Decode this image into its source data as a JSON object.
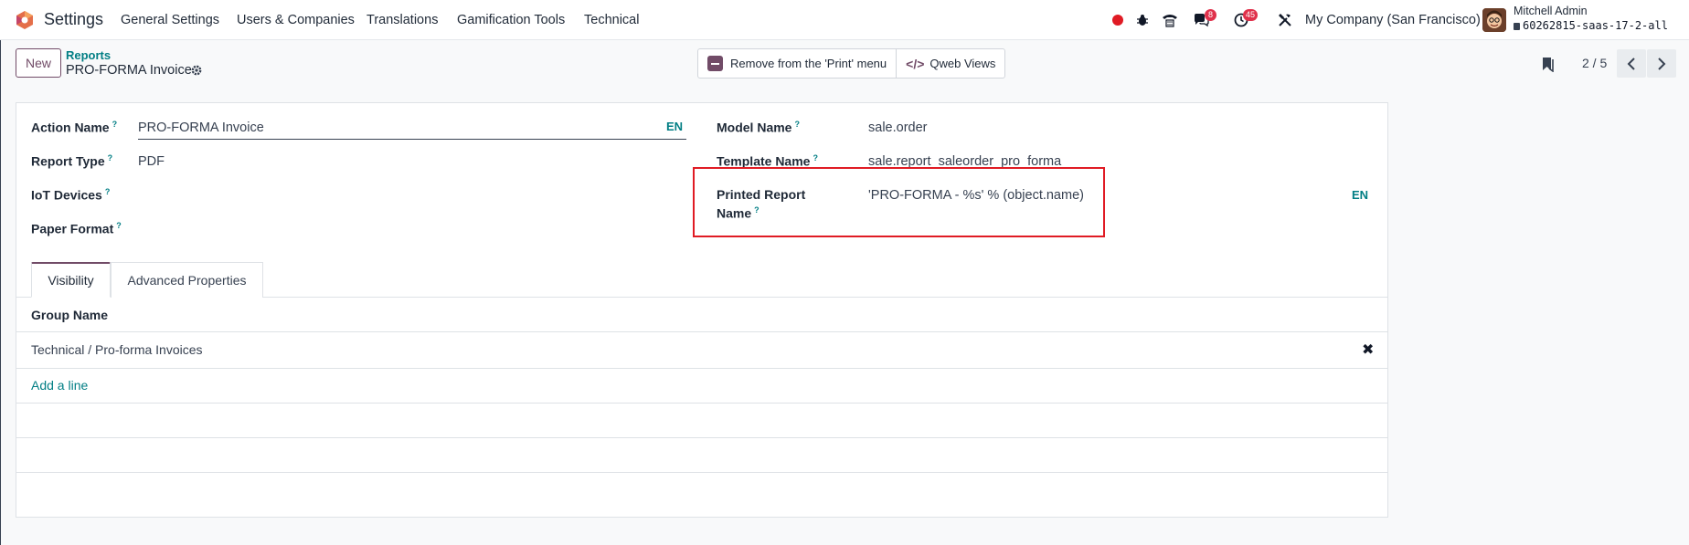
{
  "navbar": {
    "app_name": "Settings",
    "menu": [
      "General Settings",
      "Users & Companies",
      "Translations",
      "Gamification Tools",
      "Technical"
    ],
    "chat_count": "8",
    "activity_count": "45",
    "company": "My Company (San Francisco)",
    "user_name": "Mitchell Admin",
    "database": "60262815-saas-17-2-all",
    "icons": [
      "record-dot-icon",
      "bug-icon",
      "phone-icon",
      "chat-icon",
      "activity-clock-icon",
      "tools-icon"
    ]
  },
  "control_panel": {
    "new_label": "New",
    "breadcrumb": "Reports",
    "record_title": "PRO-FORMA Invoice",
    "remove_print_label": "Remove from the 'Print' menu",
    "qweb_views_label": "Qweb Views",
    "pager": "2 / 5"
  },
  "form": {
    "action_name_label": "Action Name",
    "action_name_value": "PRO-FORMA Invoice",
    "lang": "EN",
    "report_type_label": "Report Type",
    "report_type_value": "PDF",
    "iot_devices_label": "IoT Devices",
    "paper_format_label": "Paper Format",
    "model_name_label": "Model Name",
    "model_name_value": "sale.order",
    "template_name_label": "Template Name",
    "template_name_value": "sale.report_saleorder_pro_forma",
    "printed_report_label_1": "Printed Report",
    "printed_report_label_2": "Name",
    "printed_report_value": "'PRO-FORMA - %s' % (object.name)",
    "help_mark": "?"
  },
  "tabs": [
    "Visibility",
    "Advanced Properties"
  ],
  "list": {
    "header": "Group Name",
    "rows": [
      "Technical / Pro-forma Invoices"
    ],
    "add_line": "Add a line"
  },
  "colors": {
    "brand": "#714b67",
    "link": "#017e84",
    "highlight": "#e01b24",
    "badge": "#e0314b"
  }
}
